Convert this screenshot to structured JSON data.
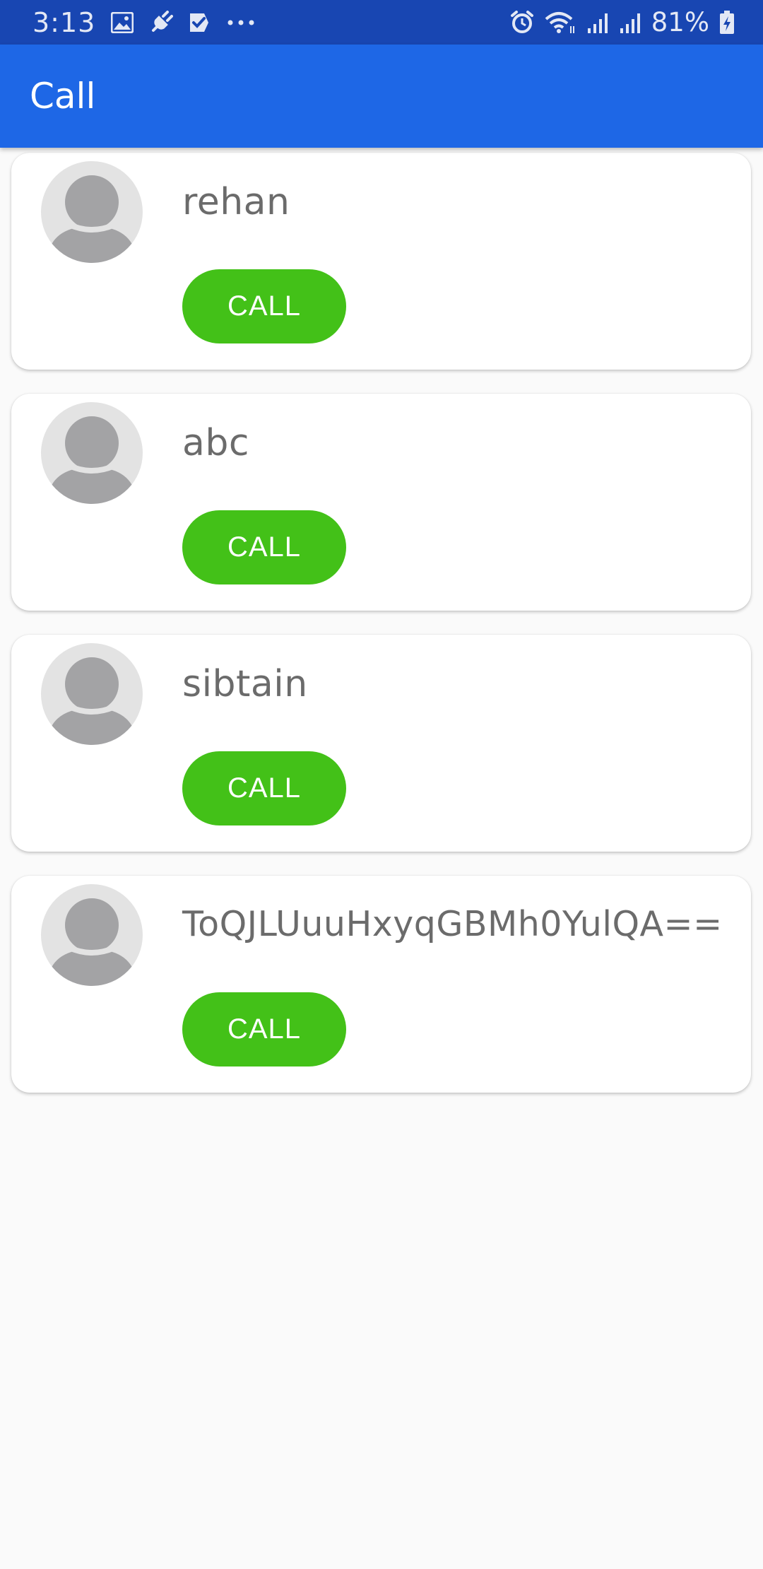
{
  "status_bar": {
    "time": "3:13",
    "battery_percent": "81%",
    "icons_left": [
      "image-icon",
      "plug-icon",
      "check-icon",
      "more-dots-icon"
    ],
    "icons_right": [
      "alarm-icon",
      "wifi-icon",
      "signal-icon",
      "signal-icon",
      "battery-charging-icon"
    ],
    "background": "#1846b2"
  },
  "app_bar": {
    "title": "Call",
    "background": "#1e67e6"
  },
  "contacts": [
    {
      "name": "rehan",
      "button_label": "CALL"
    },
    {
      "name": "abc",
      "button_label": "CALL"
    },
    {
      "name": "sibtain",
      "button_label": "CALL"
    },
    {
      "name": "ToQJLUuuHxyqGBMh0YulQA==",
      "button_label": "CALL"
    }
  ],
  "colors": {
    "call_button": "#43c118",
    "avatar_bg": "#e3e3e3",
    "avatar_figure": "#a3a3a5",
    "name_text": "#6b6b6b"
  }
}
